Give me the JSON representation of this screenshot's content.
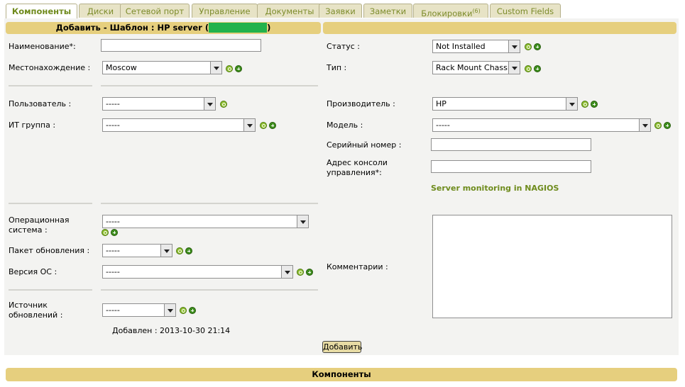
{
  "tabs": [
    {
      "label": "Компоненты",
      "active": true
    },
    {
      "label": "Диски"
    },
    {
      "label": "Сетевой порт"
    },
    {
      "label": "Управление"
    },
    {
      "label": "Документы"
    },
    {
      "label": "Заявки"
    },
    {
      "label": "Заметки"
    },
    {
      "label": "Блокировки",
      "count": "(6)"
    },
    {
      "label": "Custom Fields"
    }
  ],
  "header": {
    "title_prefix": "Добавить - Шаблон : HP server (",
    "title_suffix": ")"
  },
  "form": {
    "name_label": "Наименование*:",
    "name_value": "",
    "location_label": "Местонахождение :",
    "location_value": "Moscow",
    "user_label": "Пользователь :",
    "user_value": "-----",
    "itgroup_label": "ИТ группа :",
    "itgroup_value": "-----",
    "os_label_1": "Операционная",
    "os_label_2": "система :",
    "os_value": "-----",
    "sp_label": "Пакет обновления :",
    "sp_value": "-----",
    "osver_label": "Версия ОС :",
    "osver_value": "-----",
    "updsrc_label_1": "Источник",
    "updsrc_label_2": "обновлений :",
    "updsrc_value": "-----",
    "added": "Добавлен : 2013-10-30 21:14",
    "status_label": "Статус :",
    "status_value": "Not Installed",
    "type_label": "Тип :",
    "type_value": "Rack Mount Chassis",
    "manufacturer_label": "Производитель :",
    "manufacturer_value": "HP",
    "model_label": "Модель :",
    "model_value": "-----",
    "serial_label": "Серийный номер :",
    "serial_value": "",
    "console_label_1": "Адрес консоли",
    "console_label_2": "управления*:",
    "console_value": "",
    "nagios_link": "Server monitoring in NAGIOS",
    "comments_label": "Комментарии :",
    "submit_label": "Добавить"
  },
  "footer": {
    "title": "Компоненты"
  },
  "colors": {
    "header_bg": "#e6cf7e",
    "tab_text": "#7d8c2c",
    "link_green": "#6e8b1c",
    "redaction": "#23b24c"
  }
}
